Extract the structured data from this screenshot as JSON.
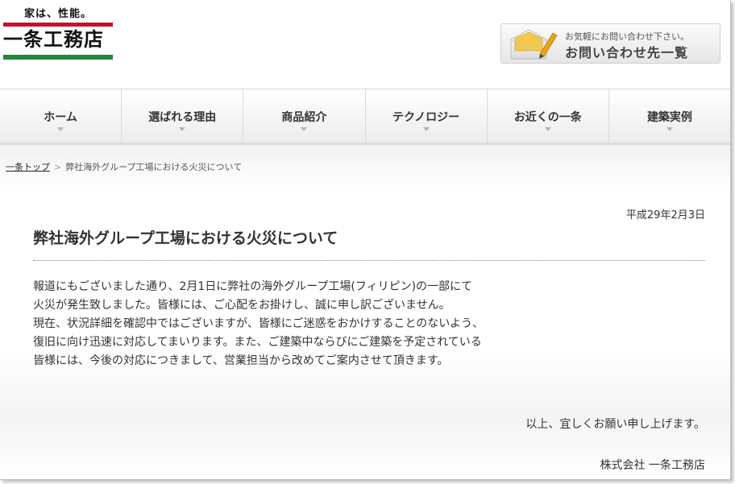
{
  "header": {
    "logo_tagline": "家は、性能。",
    "logo_name": "一条工務店",
    "contact_small": "お気軽にお問い合わせ下さい。",
    "contact_big": "お問い合わせ先一覧",
    "contact_icon": "envelope-pencil-icon"
  },
  "nav": {
    "items": [
      {
        "label": "ホーム"
      },
      {
        "label": "選ばれる理由"
      },
      {
        "label": "商品紹介"
      },
      {
        "label": "テクノロジー"
      },
      {
        "label": "お近くの一条"
      },
      {
        "label": "建築実例"
      }
    ]
  },
  "breadcrumb": {
    "home": "一条トップ",
    "separator": ">",
    "current": "弊社海外グループ工場における火災について"
  },
  "article": {
    "date": "平成29年2月3日",
    "title": "弊社海外グループ工場における火災について",
    "lines": [
      "報道にもございました通り、2月1日に弊社の海外グループ工場(フィリピン)の一部にて",
      "火災が発生致しました。皆様には、ご心配をお掛けし、誠に申し訳ございません。",
      "現在、状況詳細を確認中ではございますが、皆様にご迷惑をおかけすることのないよう、",
      "復旧に向け迅速に対応してまいります。また、ご建築中ならびにご建築を予定されている",
      "皆様には、今後の対応につきまして、営業担当から改めてご案内させて頂きます。"
    ],
    "closing": "以上、宜しくお願い申し上げます。",
    "company": "株式会社 一条工務店"
  },
  "colors": {
    "logo_red": "#c8102e",
    "logo_green": "#1f8a3a"
  }
}
